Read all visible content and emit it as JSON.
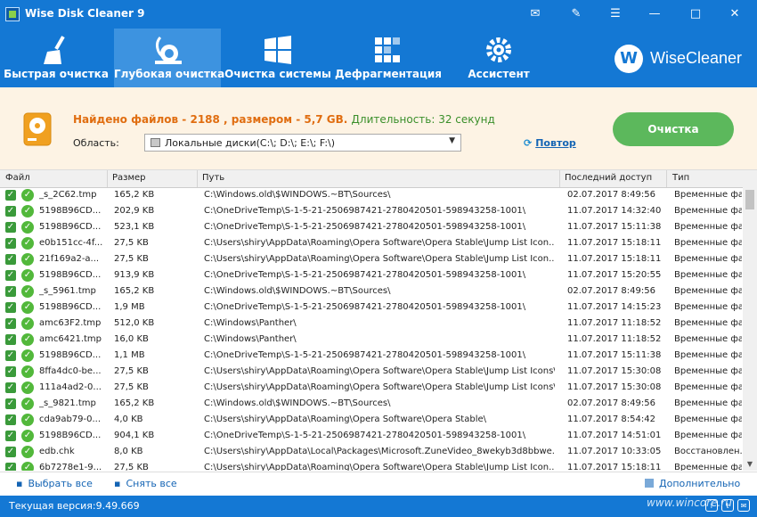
{
  "app": {
    "title": "Wise Disk Cleaner 9"
  },
  "toolbar": {
    "tabs": [
      {
        "label": "Быстрая очистка",
        "icon": "broom-icon"
      },
      {
        "label": "Глубокая очистка",
        "icon": "vacuum-icon",
        "active": true
      },
      {
        "label": "Очистка системы",
        "icon": "windows-icon"
      },
      {
        "label": "Дефрагментация",
        "icon": "defrag-icon"
      },
      {
        "label": "Ассистент",
        "icon": "gears-icon"
      }
    ],
    "brand": {
      "logo_letter": "W",
      "name": "WiseCleaner"
    }
  },
  "summary": {
    "found": "Найдено файлов - 2188 , размером - 5,7 GB.",
    "duration": "Длительность: 32 секунд",
    "area_label": "Область:",
    "area_value": "Локальные диски(C:\\; D:\\; E:\\; F:\\)",
    "rescan_label": "Повтор",
    "clean_button": "Очистка"
  },
  "table": {
    "columns": [
      "Файл",
      "Размер",
      "Путь",
      "Последний доступ",
      "Тип"
    ],
    "rows": [
      {
        "file": "_s_2C62.tmp",
        "size": "165,2 KB",
        "path": "C:\\Windows.old\\$WINDOWS.~BT\\Sources\\",
        "access": "02.07.2017 8:49:56",
        "type": "Временные фа..."
      },
      {
        "file": "5198B96CD...",
        "size": "202,9 KB",
        "path": "C:\\OneDriveTemp\\S-1-5-21-2506987421-2780420501-598943258-1001\\",
        "access": "11.07.2017 14:32:40",
        "type": "Временные фа..."
      },
      {
        "file": "5198B96CD...",
        "size": "523,1 KB",
        "path": "C:\\OneDriveTemp\\S-1-5-21-2506987421-2780420501-598943258-1001\\",
        "access": "11.07.2017 15:11:38",
        "type": "Временные фа..."
      },
      {
        "file": "e0b151cc-4f...",
        "size": "27,5 KB",
        "path": "C:\\Users\\shiry\\AppData\\Roaming\\Opera Software\\Opera Stable\\Jump List Icon...",
        "access": "11.07.2017 15:18:11",
        "type": "Временные фа..."
      },
      {
        "file": "21f169a2-a...",
        "size": "27,5 KB",
        "path": "C:\\Users\\shiry\\AppData\\Roaming\\Opera Software\\Opera Stable\\Jump List Icon...",
        "access": "11.07.2017 15:18:11",
        "type": "Временные фа..."
      },
      {
        "file": "5198B96CD...",
        "size": "913,9 KB",
        "path": "C:\\OneDriveTemp\\S-1-5-21-2506987421-2780420501-598943258-1001\\",
        "access": "11.07.2017 15:20:55",
        "type": "Временные фа..."
      },
      {
        "file": "_s_5961.tmp",
        "size": "165,2 KB",
        "path": "C:\\Windows.old\\$WINDOWS.~BT\\Sources\\",
        "access": "02.07.2017 8:49:56",
        "type": "Временные фа..."
      },
      {
        "file": "5198B96CD...",
        "size": "1,9 MB",
        "path": "C:\\OneDriveTemp\\S-1-5-21-2506987421-2780420501-598943258-1001\\",
        "access": "11.07.2017 14:15:23",
        "type": "Временные фа..."
      },
      {
        "file": "amc63F2.tmp",
        "size": "512,0 KB",
        "path": "C:\\Windows\\Panther\\",
        "access": "11.07.2017 11:18:52",
        "type": "Временные фа..."
      },
      {
        "file": "amc6421.tmp",
        "size": "16,0 KB",
        "path": "C:\\Windows\\Panther\\",
        "access": "11.07.2017 11:18:52",
        "type": "Временные фа..."
      },
      {
        "file": "5198B96CD...",
        "size": "1,1 MB",
        "path": "C:\\OneDriveTemp\\S-1-5-21-2506987421-2780420501-598943258-1001\\",
        "access": "11.07.2017 15:11:38",
        "type": "Временные фа..."
      },
      {
        "file": "8ffa4dc0-be...",
        "size": "27,5 KB",
        "path": "C:\\Users\\shiry\\AppData\\Roaming\\Opera Software\\Opera Stable\\Jump List Icons\\",
        "access": "11.07.2017 15:30:08",
        "type": "Временные фа..."
      },
      {
        "file": "111a4ad2-0...",
        "size": "27,5 KB",
        "path": "C:\\Users\\shiry\\AppData\\Roaming\\Opera Software\\Opera Stable\\Jump List Icons\\",
        "access": "11.07.2017 15:30:08",
        "type": "Временные фа..."
      },
      {
        "file": "_s_9821.tmp",
        "size": "165,2 KB",
        "path": "C:\\Windows.old\\$WINDOWS.~BT\\Sources\\",
        "access": "02.07.2017 8:49:56",
        "type": "Временные фа..."
      },
      {
        "file": "cda9ab79-0...",
        "size": "4,0 KB",
        "path": "C:\\Users\\shiry\\AppData\\Roaming\\Opera Software\\Opera Stable\\",
        "access": "11.07.2017 8:54:42",
        "type": "Временные фа..."
      },
      {
        "file": "5198B96CD...",
        "size": "904,1 KB",
        "path": "C:\\OneDriveTemp\\S-1-5-21-2506987421-2780420501-598943258-1001\\",
        "access": "11.07.2017 14:51:01",
        "type": "Временные фа..."
      },
      {
        "file": "edb.chk",
        "size": "8,0 KB",
        "path": "C:\\Users\\shiry\\AppData\\Local\\Packages\\Microsoft.ZuneVideo_8wekyb3d8bbwe...",
        "access": "11.07.2017 10:33:05",
        "type": "Восстановлен..."
      },
      {
        "file": "6b7278e1-9...",
        "size": "27,5 KB",
        "path": "C:\\Users\\shiry\\AppData\\Roaming\\Opera Software\\Opera Stable\\Jump List Icon...",
        "access": "11.07.2017 15:18:11",
        "type": "Временные фа..."
      }
    ]
  },
  "footer": {
    "select_all": "Выбрать все",
    "deselect_all": "Снять все",
    "more": "Дополнительно"
  },
  "status": {
    "version": "Текущая версия:9.49.669",
    "watermark": "www.wincore.ru"
  },
  "colors": {
    "accent": "#1478d4",
    "active_tab": "#3d93e0",
    "clean_button": "#5cb85c",
    "found_text": "#e06d10",
    "duration_text": "#3a8f2a",
    "summary_bg": "#fdf3e4"
  }
}
